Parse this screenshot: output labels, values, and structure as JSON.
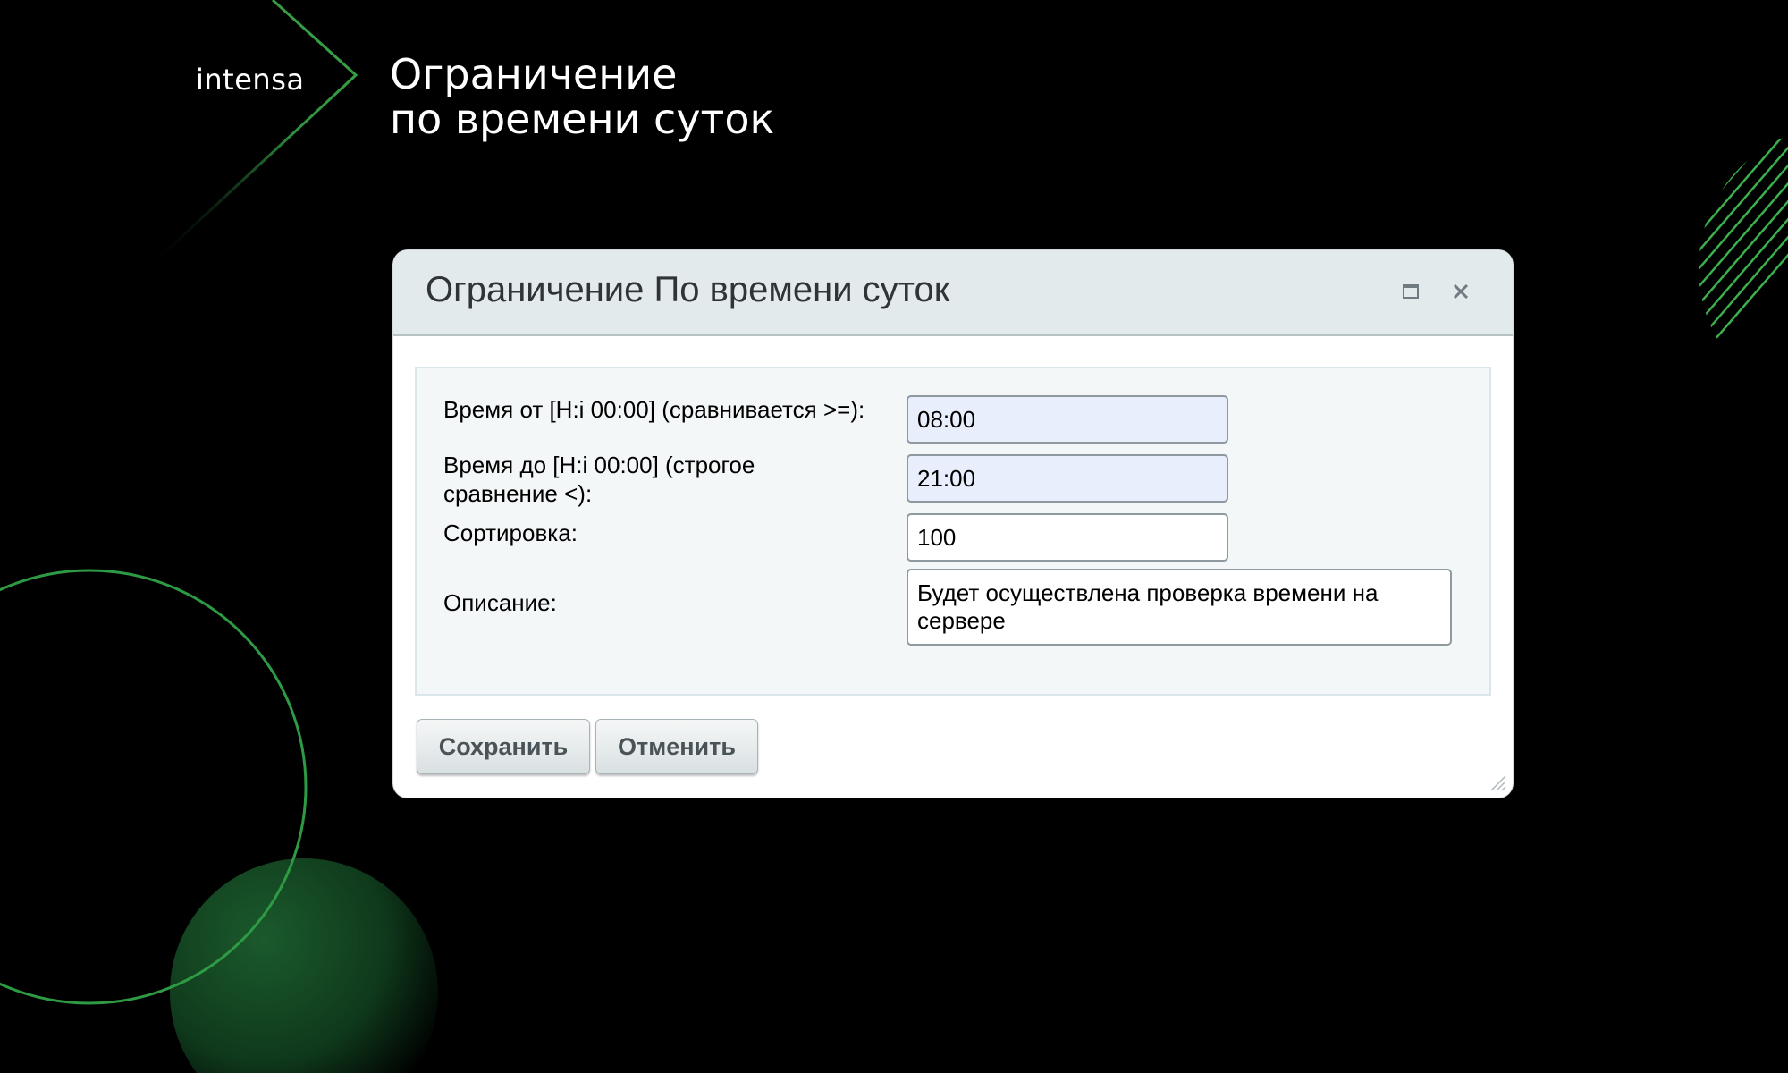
{
  "brand": {
    "logo_text": "intensa"
  },
  "slide": {
    "title_line1": "Ограничение",
    "title_line2": "по времени суток"
  },
  "colors": {
    "accent_green": "#3aa84a",
    "dialog_header": "#e2eaec",
    "field_filled": "#e8eefc"
  },
  "dialog": {
    "title": "Ограничение По времени суток",
    "maximize_icon": "maximize-icon",
    "close_icon": "close-icon",
    "fields": {
      "time_from": {
        "label": "Время от [H:i 00:00] (сравнивается >=):",
        "value": "08:00"
      },
      "time_to": {
        "label_line1": "Время до [H:i 00:00] (строгое",
        "label_line2": "сравнение <):",
        "value": "21:00"
      },
      "sort": {
        "label": "Сортировка:",
        "value": "100"
      },
      "description": {
        "label": "Описание:",
        "value_line1": "Будет осуществлена проверка времени на",
        "value_line2": "сервере"
      }
    },
    "buttons": {
      "save": "Сохранить",
      "cancel": "Отменить"
    }
  }
}
